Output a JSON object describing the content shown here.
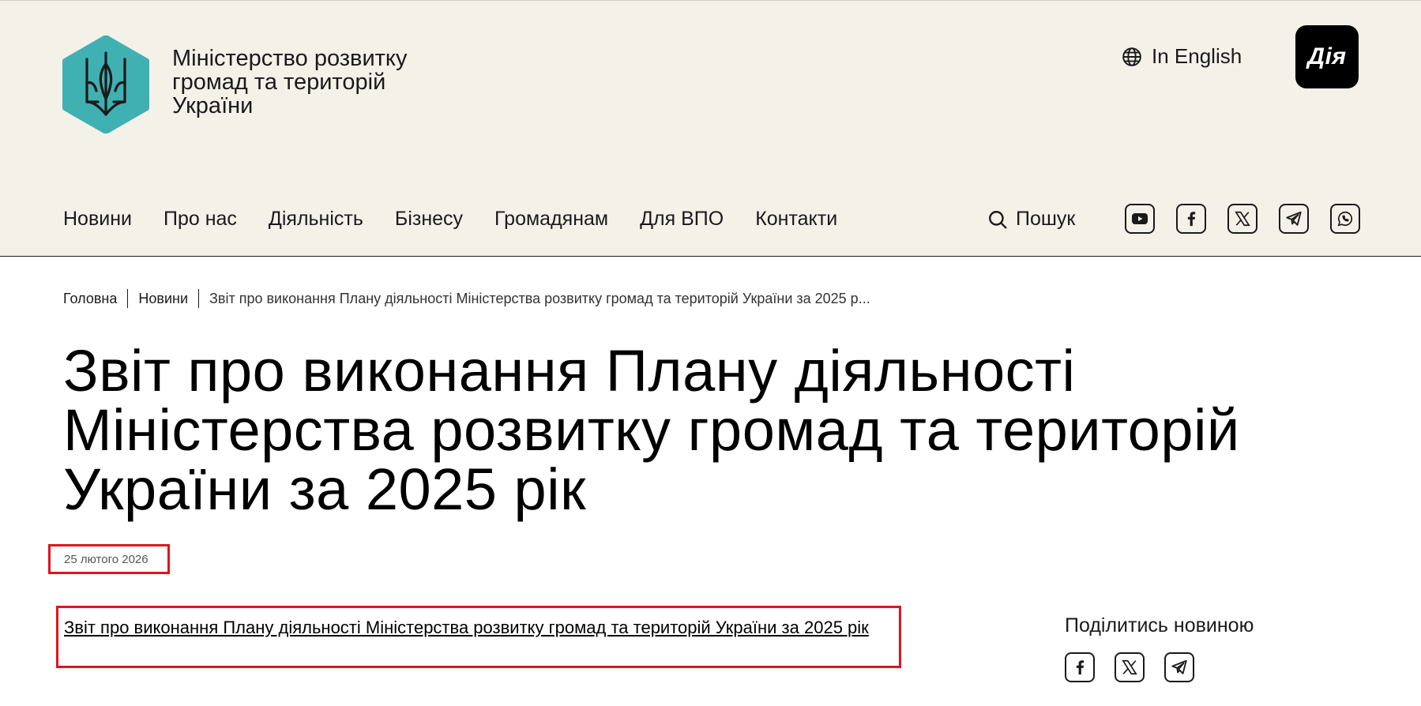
{
  "header": {
    "org_name_lines": [
      "Міністерство розвитку",
      "громад та територій",
      "України"
    ],
    "lang_label": "In English",
    "diia_label": "Дія",
    "nav": [
      "Новини",
      "Про нас",
      "Діяльність",
      "Бізнесу",
      "Громадянам",
      "Для ВПО",
      "Контакти"
    ],
    "search_label": "Пошук",
    "socials": [
      "youtube-icon",
      "facebook-icon",
      "x-icon",
      "telegram-icon",
      "whatsapp-icon"
    ]
  },
  "breadcrumb": {
    "home": "Головна",
    "news": "Новини",
    "current": "Звіт про виконання Плану діяльності Міністерства розвитку громад та територій України за 2025 р..."
  },
  "article": {
    "title": "Звіт про виконання Плану діяльності Міністерства розвитку громад та територій України за 2025 рік",
    "date": "25 лютого 2026",
    "doc_link": "Звіт про виконання Плану діяльності Міністерства розвитку громад та територій України за 2025 рік"
  },
  "share": {
    "title": "Поділитись новиною",
    "icons": [
      "facebook-icon",
      "x-icon",
      "telegram-icon"
    ]
  },
  "colors": {
    "header_bg": "#f4f1e9",
    "logo_teal": "#3fb1b3",
    "highlight_red": "#e0141e"
  }
}
